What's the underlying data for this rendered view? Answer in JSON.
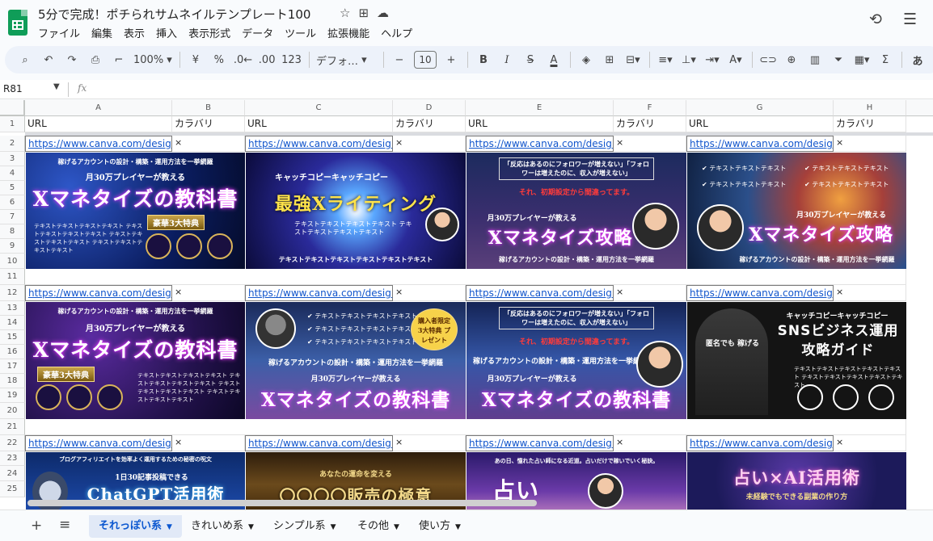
{
  "document": {
    "title": "5分で完成！ポチられサムネイルテンプレート100"
  },
  "menu": [
    "ファイル",
    "編集",
    "表示",
    "挿入",
    "表示形式",
    "データ",
    "ツール",
    "拡張機能",
    "ヘルプ"
  ],
  "toolbar": {
    "zoom": "100%",
    "currency": "¥",
    "percent": "%",
    "decrease_decimals": ".0←",
    "increase_decimals": ".00",
    "number_format": "123",
    "font": "デフォ…",
    "font_size": "10",
    "minus": "−",
    "plus": "+",
    "bold": "B",
    "italic": "I",
    "strike": "S",
    "text_color": "A",
    "sigma": "Σ",
    "input_method": "あ"
  },
  "formula_bar": {
    "name_box": "R81",
    "fx": "fx"
  },
  "columns": [
    "A",
    "B",
    "C",
    "D",
    "E",
    "F",
    "G",
    "H"
  ],
  "rows": [
    "1",
    "2",
    "3",
    "4",
    "5",
    "6",
    "7",
    "8",
    "9",
    "10",
    "11",
    "12",
    "13",
    "14",
    "15",
    "16",
    "17",
    "18",
    "19",
    "20",
    "21",
    "22",
    "23",
    "24",
    "25"
  ],
  "header_row": [
    "URL",
    "カラバリ",
    "URL",
    "カラバリ",
    "URL",
    "カラバリ",
    "URL",
    "カラバリ"
  ],
  "url_text": "https://www.canva.com/design/DA",
  "mark": "×",
  "banners": {
    "r1": [
      {
        "sub": "稼げるアカウントの設計・構築・運用方法を一挙網羅",
        "kicker": "月30万プレイヤーが教える",
        "title": "Xマネタイズの教科書",
        "badge": "豪華3大特典",
        "body": "テキストテキストテキストテキスト テキストテキストテキストテキスト テキストテキストテキストテキスト テキストテキストテキストテキスト"
      },
      {
        "kicker": "キャッチコピーキャッチコピー",
        "title": "最強Xライティング",
        "body": "テキストテキストテキストテキスト テキストテキストテキストテキスト",
        "foot": "テキストテキストテキストテキストテキストテキスト"
      },
      {
        "sub": "「反応はあるのにフォロワーが増えない」「フォロワーは増えたのに、収入が増えない」",
        "kicker": "それ、初期設定から間違ってます。",
        "title": "Xマネタイズ攻略",
        "pre": "月30万プレイヤーが教える",
        "foot": "稼げるアカウントの設計・構築・運用方法を一挙網羅"
      },
      {
        "checks": [
          "テキストテキストテキスト",
          "テキストテキストテキスト",
          "テキストテキストテキスト",
          "テキストテキストテキスト"
        ],
        "pre": "月30万プレイヤーが教える",
        "title": "Xマネタイズ攻略",
        "foot": "稼げるアカウントの設計・構築・運用方法を一挙網羅"
      }
    ],
    "r2": [
      {
        "sub": "稼げるアカウントの設計・構築・運用方法を一挙網羅",
        "kicker": "月30万プレイヤーが教える",
        "title": "Xマネタイズの教科書",
        "badge": "豪華3大特典",
        "body": "テキストテキストテキストテキスト テキストテキストテキストテキスト テキストテキストテキストテキスト テキストテキストテキストテキスト"
      },
      {
        "checks": [
          "テキストテキストテキストテキスト",
          "テキストテキストテキストテキスト",
          "テキストテキストテキストテキスト"
        ],
        "badge": "購入者限定 3大特典 プレゼント",
        "sub": "稼げるアカウントの設計・構築・運用方法を一挙網羅",
        "pre": "月30万プレイヤーが教える",
        "title": "Xマネタイズの教科書"
      },
      {
        "sub": "「反応はあるのにフォロワーが増えない」「フォロワーは増えたのに、収入が増えない」",
        "kicker": "それ、初期設定から間違ってます。",
        "foot": "稼げるアカウントの設計・構築・運用方法を一挙網羅",
        "pre": "月30万プレイヤーが教える",
        "title": "Xマネタイズの教科書"
      },
      {
        "kicker": "キャッチコピーキャッチコピー",
        "title": "SNSビジネス運用 攻略ガイド",
        "side": "匿名でも 稼げる",
        "body": "テキストテキストテキストテキストテキスト テキストテキストテキストテキストテキスト"
      }
    ],
    "r3": [
      {
        "sub": "ブログアフィリエイトを効率よく運用するための秘密の呪文",
        "kicker": "1日30記事投稿できる",
        "title": "ChatGPT活用術"
      },
      {
        "kicker": "あなたの運命を変える",
        "title": "〇〇〇〇販売の極意"
      },
      {
        "sub": "あの日、憧れた占い師になる近道。占いだけで稼いでいく秘訣。",
        "title": "占い"
      },
      {
        "title": "占い×AI活用術",
        "kicker": "未経験でもできる副業の作り方"
      }
    ]
  },
  "tabs": [
    {
      "label": "それっぽい系",
      "active": true
    },
    {
      "label": "きれいめ系"
    },
    {
      "label": "シンプル系"
    },
    {
      "label": "その他"
    },
    {
      "label": "使い方"
    }
  ]
}
